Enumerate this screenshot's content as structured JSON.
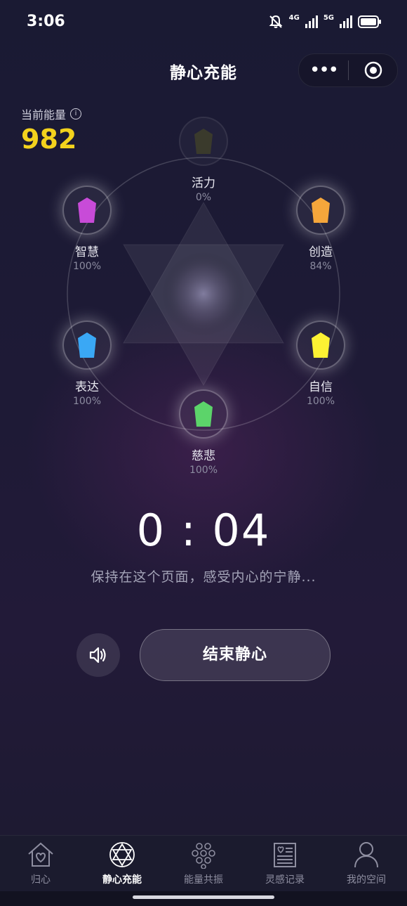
{
  "status_bar": {
    "time": "3:06",
    "sig1": "4G",
    "sig2": "5G"
  },
  "header": {
    "title": "静心充能",
    "more_icon": "more-dots-icon",
    "target_icon": "target-circle-icon"
  },
  "energy": {
    "label": "当前能量",
    "value": "982"
  },
  "chakras": [
    {
      "name": "活力",
      "pct": "0%",
      "color": "#3a3a2c"
    },
    {
      "name": "创造",
      "pct": "84%",
      "color": "#f5a63b"
    },
    {
      "name": "自信",
      "pct": "100%",
      "color": "#fdf233"
    },
    {
      "name": "慈悲",
      "pct": "100%",
      "color": "#5cd46a"
    },
    {
      "name": "表达",
      "pct": "100%",
      "color": "#3aa8f5"
    },
    {
      "name": "智慧",
      "pct": "100%",
      "color": "#c84bd8"
    }
  ],
  "timer": {
    "value": "0 : 04",
    "hint": "保持在这个页面，感受内心的宁静..."
  },
  "controls": {
    "sound_icon": "speaker-icon",
    "end_label": "结束静心"
  },
  "tabs": [
    {
      "label": "归心",
      "icon": "house-heart-icon"
    },
    {
      "label": "静心充能",
      "icon": "star-of-david-icon",
      "active": true
    },
    {
      "label": "能量共振",
      "icon": "honeycomb-icon"
    },
    {
      "label": "灵感记录",
      "icon": "journal-icon"
    },
    {
      "label": "我的空间",
      "icon": "user-icon"
    }
  ]
}
